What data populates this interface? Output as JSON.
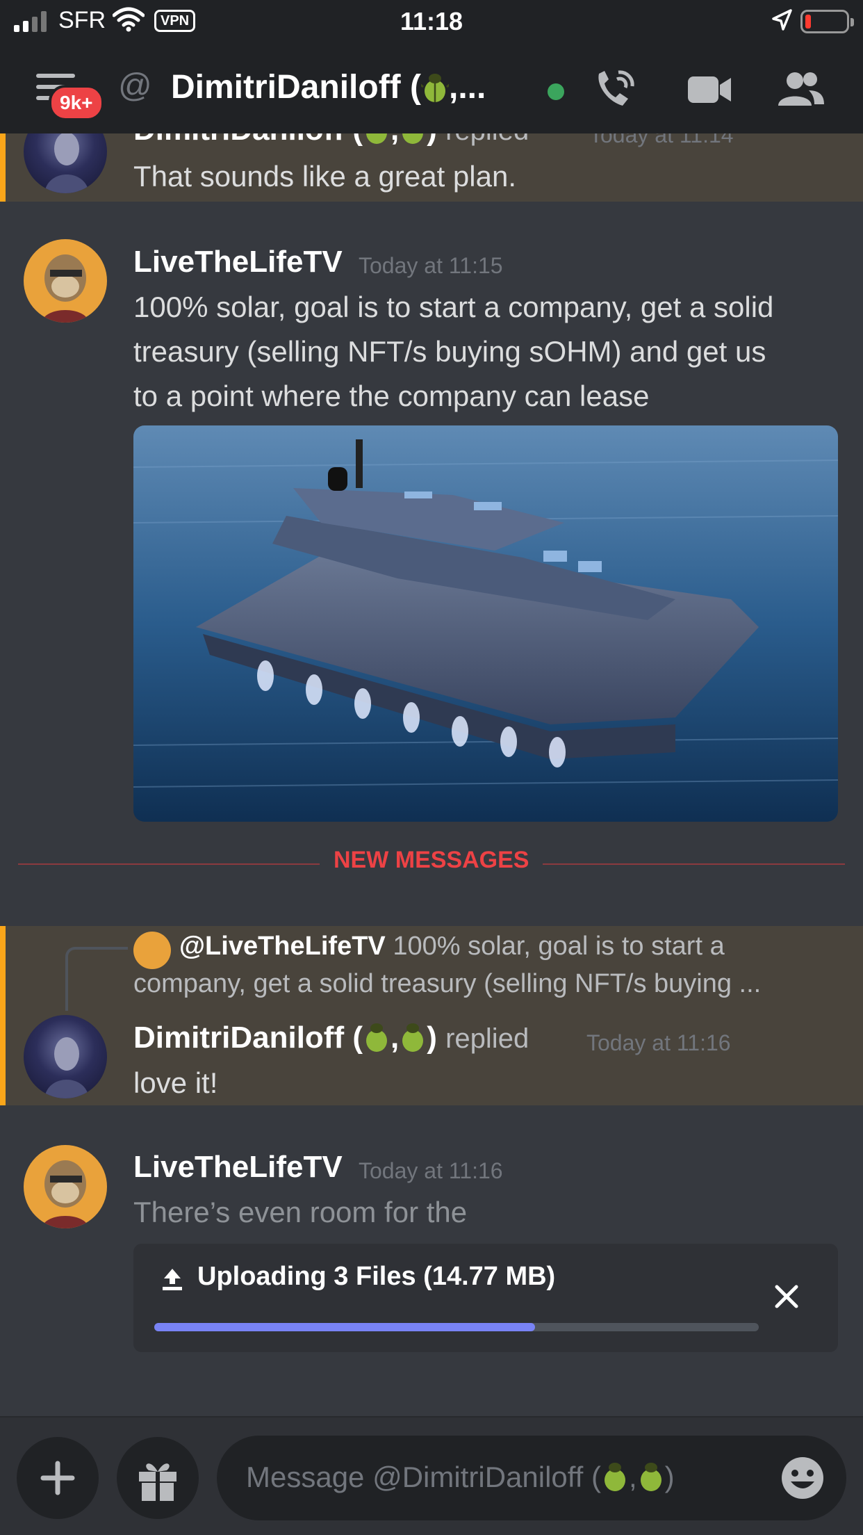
{
  "status_bar": {
    "carrier": "SFR",
    "vpn": "VPN",
    "time": "11:18"
  },
  "header": {
    "badge": "9k+",
    "at_symbol": "@",
    "channel_title": "DimitriDaniloff (",
    "channel_title_suffix": ",...",
    "online_color": "#3ba55d"
  },
  "messages": [
    {
      "author": "DimitriDaniloff (",
      "author_suffix": ")",
      "replied": "replied",
      "timestamp": "Today at 11:14",
      "text": "That sounds like a great plan.",
      "highlighted": true
    },
    {
      "author": "LiveTheLifeTV",
      "timestamp": "Today at 11:15",
      "text_lines": [
        "100% solar, goal is to start a company, get a solid",
        "treasury (selling NFT/s buying sOHM) and get us",
        "to a point where the company can lease"
      ],
      "attachment": "catamaran image"
    },
    {
      "reply_to": {
        "mention": "@LiveTheLifeTV",
        "preview_line1": "100% solar, goal is to start a",
        "preview_line2": "company, get a solid treasury (selling NFT/s buying ..."
      },
      "author": "DimitriDaniloff (",
      "author_suffix": ")",
      "replied": "replied",
      "timestamp": "Today at 11:16",
      "text": "love it!",
      "highlighted": true
    },
    {
      "author": "LiveTheLifeTV",
      "timestamp": "Today at 11:16",
      "text": "There’s even room for the"
    }
  ],
  "divider": {
    "label": "NEW MESSAGES"
  },
  "upload": {
    "label": "Uploading 3 Files  (14.77 MB)",
    "progress": 0.63
  },
  "composer": {
    "placeholder": "Message @DimitriDaniloff (",
    "placeholder_end": ")"
  },
  "colors": {
    "accent": "#5865f2",
    "mention_highlight": "#faa61a",
    "new_messages": "#ed4245"
  },
  "icons": [
    "menu-icon",
    "at-icon",
    "call-icon",
    "video-icon",
    "members-icon",
    "add-icon",
    "gift-icon",
    "emoji-icon",
    "upload-icon",
    "close-icon",
    "beetle-emoji"
  ]
}
